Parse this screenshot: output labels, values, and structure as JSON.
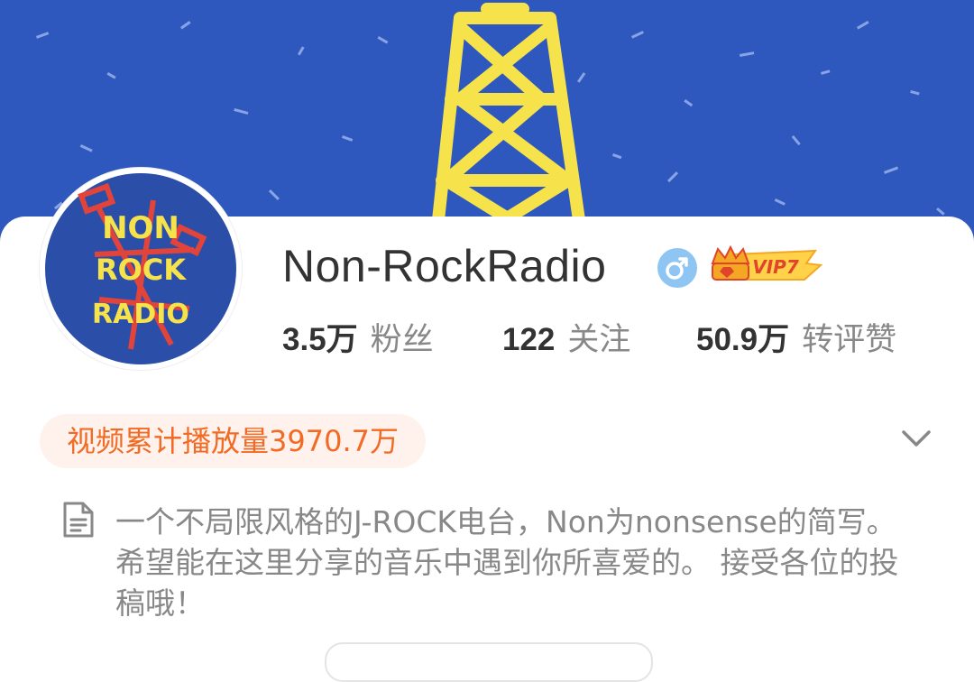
{
  "profile": {
    "username": "Non-RockRadio",
    "gender_icon": "male-icon",
    "vip_label": "VIP7",
    "avatar_text": [
      "NON",
      "ROCK",
      "RADIO"
    ]
  },
  "stats": [
    {
      "value": "3.5万",
      "label": "粉丝"
    },
    {
      "value": "122",
      "label": "关注"
    },
    {
      "value": "50.9万",
      "label": "转评赞"
    }
  ],
  "video_badge": "视频累计播放量3970.7万",
  "bio": "一个不局限风格的J-ROCK电台，Non为nonsense的简写。希望能在这里分享的音乐中遇到你所喜爱的。 接受各位的投稿哦！",
  "colors": {
    "banner_blue": "#2f58bf",
    "banner_yellow": "#f6e24a",
    "badge_orange": "#f26a23",
    "badge_bg": "#fff2ec",
    "gender_blue": "#8ec5f3",
    "vip_gold": "#f4a722"
  }
}
